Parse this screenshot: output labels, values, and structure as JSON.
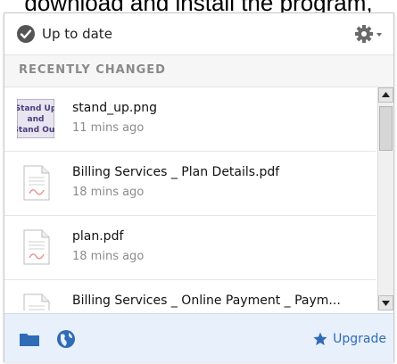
{
  "page_text_top": "download and install the program,",
  "status": {
    "text": "Up to date",
    "icon": "check-circle-icon"
  },
  "settings": {
    "icon": "gear-dropdown-icon"
  },
  "section": {
    "title": "RECENTLY CHANGED"
  },
  "files": [
    {
      "name": "stand_up.png",
      "time": "11 mins ago",
      "icon": "image-thumbnail"
    },
    {
      "name": "Billing Services _ Plan Details.pdf",
      "time": "18 mins ago",
      "icon": "pdf-file-icon"
    },
    {
      "name": "plan.pdf",
      "time": "18 mins ago",
      "icon": "pdf-file-icon"
    },
    {
      "name": "Billing Services _ Online Payment _ Paym...",
      "time": "",
      "icon": "pdf-file-icon"
    }
  ],
  "thumbnail_text": [
    "Stand Up",
    "and",
    "Stand Out"
  ],
  "footer": {
    "folder_icon": "folder-icon",
    "globe_icon": "globe-icon",
    "upgrade_label": "Upgrade",
    "accent": "#2f6bb6"
  }
}
